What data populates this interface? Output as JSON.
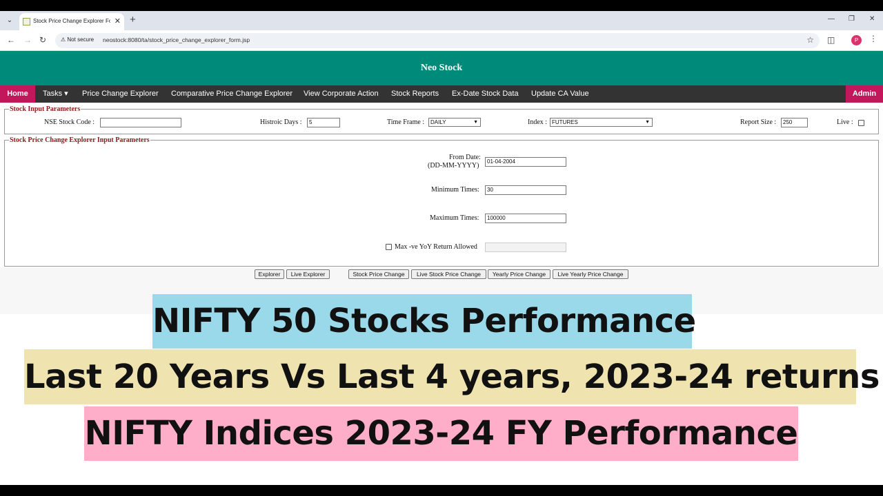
{
  "browser": {
    "tab_title": "Stock Price Change Explorer Fo",
    "security_label": "Not secure",
    "url": "neostock:8080/ta/stock_price_change_explorer_form.jsp",
    "profile_initial": "P"
  },
  "site": {
    "title": "Neo Stock"
  },
  "navbar": {
    "home": "Home",
    "tasks": "Tasks ▾",
    "items": [
      "Price Change Explorer",
      "Comparative Price Change Explorer",
      "View Corporate Action",
      "Stock Reports",
      "Ex-Date Stock Data",
      "Update CA Value"
    ],
    "admin": "Admin"
  },
  "stock_input": {
    "legend": "Stock Input Parameters",
    "nse_label": "NSE Stock Code :",
    "nse_value": "",
    "days_label": "Histroic Days :",
    "days_value": "5",
    "timeframe_label": "Time Frame :",
    "timeframe_value": "DAILY",
    "index_label": "Index :",
    "index_value": "FUTURES",
    "report_label": "Report Size :",
    "report_value": "250",
    "live_label": "Live :"
  },
  "explorer_input": {
    "legend": "Stock Price Change Explorer Input Parameters",
    "from_label": "From Date:",
    "from_format": "(DD-MM-YYYY)",
    "from_value": "01-04-2004",
    "min_label": "Minimum Times:",
    "min_value": "30",
    "max_label": "Maximum Times:",
    "max_value": "100000",
    "yoy_label": "Max -ve YoY Return Allowed"
  },
  "buttons": {
    "explorer": "Explorer",
    "live_explorer": "Live Explorer",
    "stock_price_change": "Stock Price Change",
    "live_stock_price_change": "Live Stock Price Change",
    "yearly_price_change": "Yearly Price Change",
    "live_yearly_price_change": "Live Yearly Price Change"
  },
  "captions": {
    "line1": "NIFTY 50 Stocks Performance",
    "line2": "Last 20 Years Vs Last 4 years, 2023-24 returns",
    "line3": "NIFTY Indices 2023-24 FY Performance"
  },
  "colors": {
    "header_teal": "#008a7a",
    "nav_dark": "#333333",
    "nav_active": "#c2185b",
    "legend_red": "#8b1a1a",
    "caption1_bg": "#99d9ea",
    "caption2_bg": "#efe4b0",
    "caption3_bg": "#ffaec9"
  }
}
